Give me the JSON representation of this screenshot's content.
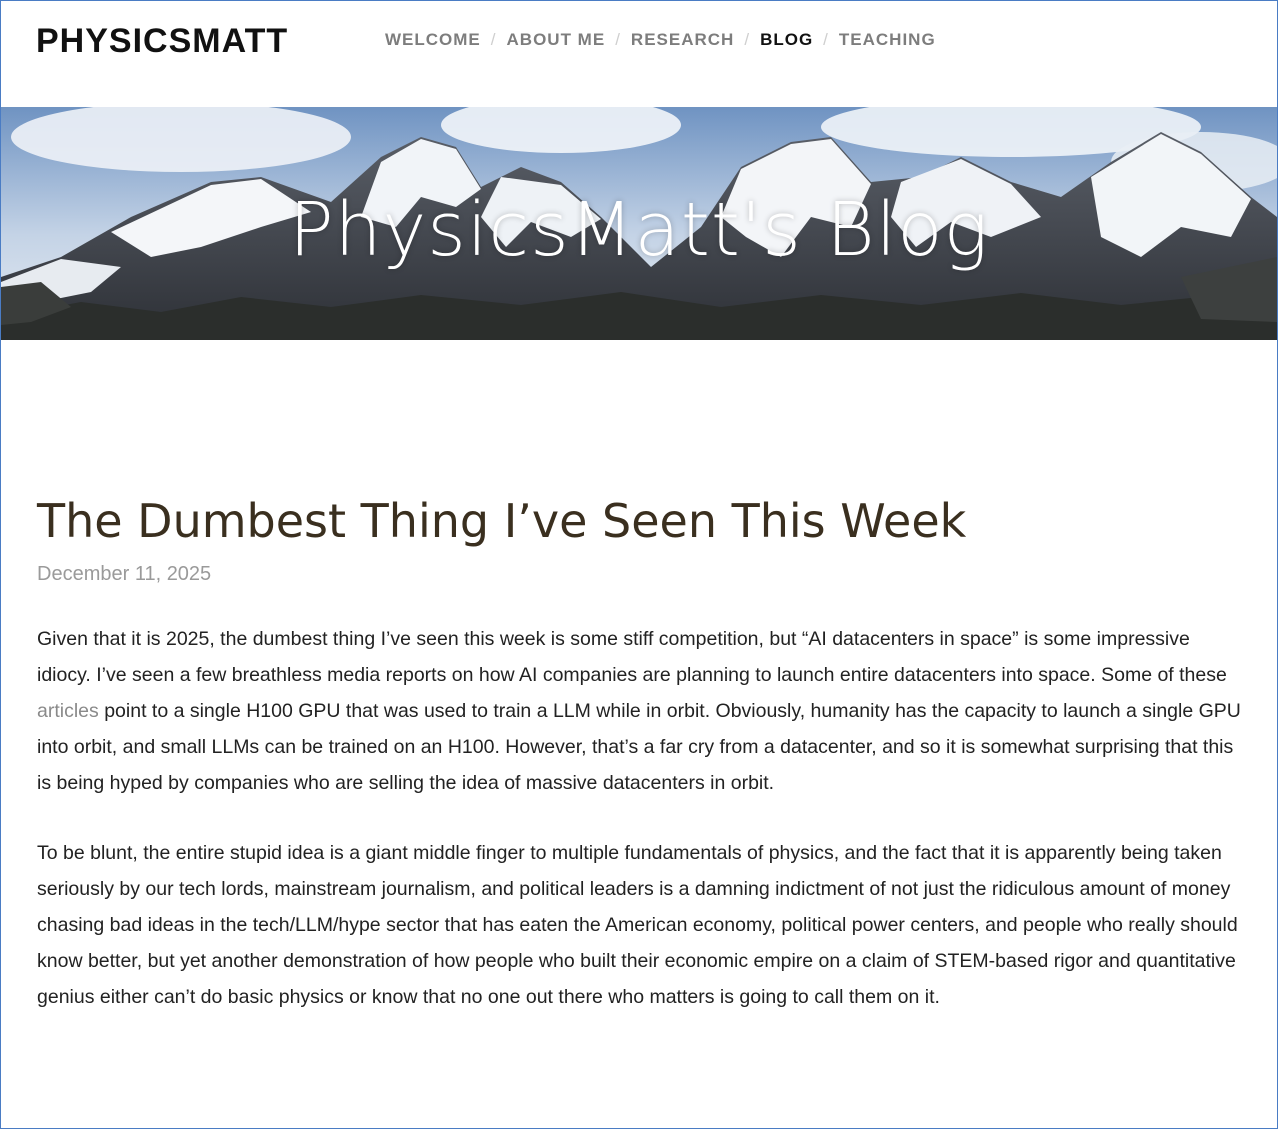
{
  "site": {
    "title": "PHYSICSMATT"
  },
  "nav": {
    "items": [
      {
        "label": "WELCOME",
        "active": false
      },
      {
        "label": "ABOUT ME",
        "active": false
      },
      {
        "label": "RESEARCH",
        "active": false
      },
      {
        "label": "BLOG",
        "active": true
      },
      {
        "label": "TEACHING",
        "active": false
      }
    ],
    "separator": "/"
  },
  "hero": {
    "title": "PhysicsMatt's Blog"
  },
  "post": {
    "title": "The Dumbest Thing I’ve Seen This Week",
    "date": "December 11, 2025",
    "paragraph1": {
      "before_link": "Given that it is 2025, the dumbest thing I’ve seen this week is some stiff competition, but “AI datacenters in space” is some impressive idiocy. I’ve seen a few breathless media reports on how AI companies are planning to launch entire datacenters into space. Some of these ",
      "link_text": "articles",
      "after_link": " point to a single H100 GPU that was used to train a LLM while in orbit. Obviously, humanity has the capacity to launch a single GPU into orbit, and small LLMs can be trained on an H100. However, that’s a far cry from a datacenter, and so it is somewhat surprising that this is being hyped by companies who are selling the idea of massive datacenters in orbit."
    },
    "paragraph2": "To be blunt, the entire stupid idea is a giant middle finger to multiple fundamentals of physics, and the fact that it is apparently being taken seriously by our tech lords, mainstream journalism, and political leaders is a damning indictment of not just the ridiculous amount of money chasing bad ideas in the tech/LLM/hype sector that has eaten the American economy, political power centers, and people who really should know better, but yet another demonstration of how people who built their economic empire on a claim of STEM-based rigor and quantitative genius either can’t do basic physics or know that no one out there who matters is going to call them on it."
  },
  "colors": {
    "frame_border": "#4a7cc4",
    "nav_inactive": "#7d7d7d",
    "nav_active": "#111111",
    "title_text": "#3a2f1f",
    "date_text": "#9a9a9a",
    "link_text": "#8a8a8a"
  }
}
